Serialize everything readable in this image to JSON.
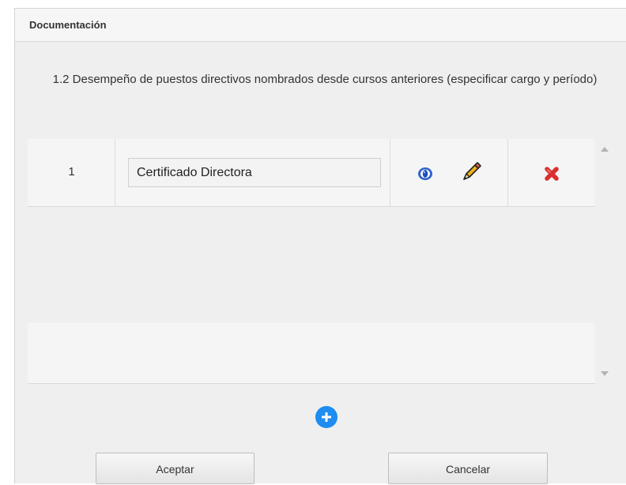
{
  "panel": {
    "title": "Documentación",
    "question": "1.2 Desempeño de puestos directivos nombrados desde cursos anteriores (especificar cargo y período)"
  },
  "documents": {
    "rows": [
      {
        "number": "1",
        "name": "Certificado Directora",
        "icons": [
          "view-icon",
          "edit-pencil-icon",
          "delete-x-icon"
        ]
      }
    ]
  },
  "buttons": {
    "add_icon": "plus-circle-icon",
    "accept": "Aceptar",
    "cancel": "Cancelar"
  },
  "colors": {
    "accent_blue": "#1e8cf0",
    "delete_red": "#d9302e",
    "panel_bg": "#efefef"
  }
}
